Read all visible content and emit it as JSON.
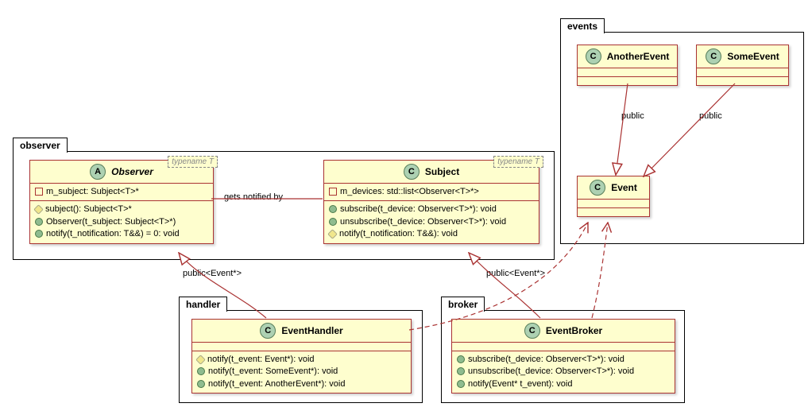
{
  "packages": {
    "observer": {
      "label": "observer"
    },
    "handler": {
      "label": "handler"
    },
    "broker": {
      "label": "broker"
    },
    "events": {
      "label": "events"
    }
  },
  "classes": {
    "Observer": {
      "stereotype": "A",
      "name": "Observer",
      "template": "typename T",
      "fields": [
        {
          "vis": "private-field",
          "text": "m_subject: Subject<T>*"
        }
      ],
      "methods": [
        {
          "vis": "protected",
          "text": "subject(): Subject<T>*"
        },
        {
          "vis": "public",
          "text": "Observer(t_subject: Subject<T>*)"
        },
        {
          "vis": "public",
          "text": "notify(t_notification: T&&) = 0: void"
        }
      ]
    },
    "Subject": {
      "stereotype": "C",
      "name": "Subject",
      "template": "typename T",
      "fields": [
        {
          "vis": "private-field",
          "text": "m_devices: std::list<Observer<T>*>"
        }
      ],
      "methods": [
        {
          "vis": "public",
          "text": "subscribe(t_device: Observer<T>*): void"
        },
        {
          "vis": "public",
          "text": "unsubscribe(t_device: Observer<T>*): void"
        },
        {
          "vis": "protected",
          "text": "notify(t_notification: T&&): void"
        }
      ]
    },
    "EventHandler": {
      "stereotype": "C",
      "name": "EventHandler",
      "methods": [
        {
          "vis": "protected",
          "text": "notify(t_event: Event*): void"
        },
        {
          "vis": "public",
          "text": "notify(t_event: SomeEvent*): void"
        },
        {
          "vis": "public",
          "text": "notify(t_event: AnotherEvent*): void"
        }
      ]
    },
    "EventBroker": {
      "stereotype": "C",
      "name": "EventBroker",
      "methods": [
        {
          "vis": "public",
          "text": "subscribe(t_device: Observer<T>*): void"
        },
        {
          "vis": "public",
          "text": "unsubscribe(t_device: Observer<T>*): void"
        },
        {
          "vis": "public",
          "text": "notify(Event* t_event): void"
        }
      ]
    },
    "Event": {
      "stereotype": "C",
      "name": "Event"
    },
    "AnotherEvent": {
      "stereotype": "C",
      "name": "AnotherEvent"
    },
    "SomeEvent": {
      "stereotype": "C",
      "name": "SomeEvent"
    }
  },
  "edges": {
    "observer_subject": "gets notified by",
    "handler_observer": "public<Event*>",
    "broker_subject": "public<Event*>",
    "another_event": "public",
    "some_event": "public"
  },
  "chart_data": {
    "type": "uml-class",
    "packages": [
      "observer",
      "handler",
      "broker",
      "events"
    ],
    "classes": [
      {
        "name": "Observer",
        "package": "observer",
        "abstract": true,
        "template": "typename T"
      },
      {
        "name": "Subject",
        "package": "observer",
        "template": "typename T"
      },
      {
        "name": "EventHandler",
        "package": "handler"
      },
      {
        "name": "EventBroker",
        "package": "broker"
      },
      {
        "name": "Event",
        "package": "events"
      },
      {
        "name": "AnotherEvent",
        "package": "events"
      },
      {
        "name": "SomeEvent",
        "package": "events"
      }
    ],
    "relations": [
      {
        "from": "Observer",
        "to": "Subject",
        "type": "association",
        "label": "gets notified by"
      },
      {
        "from": "EventHandler",
        "to": "Observer",
        "type": "generalization",
        "label": "public<Event*>"
      },
      {
        "from": "EventBroker",
        "to": "Subject",
        "type": "generalization",
        "label": "public<Event*>"
      },
      {
        "from": "EventBroker",
        "to": "Event",
        "type": "dependency"
      },
      {
        "from": "EventHandler",
        "to": "Event",
        "type": "dependency"
      },
      {
        "from": "AnotherEvent",
        "to": "Event",
        "type": "generalization",
        "label": "public"
      },
      {
        "from": "SomeEvent",
        "to": "Event",
        "type": "generalization",
        "label": "public"
      }
    ]
  }
}
